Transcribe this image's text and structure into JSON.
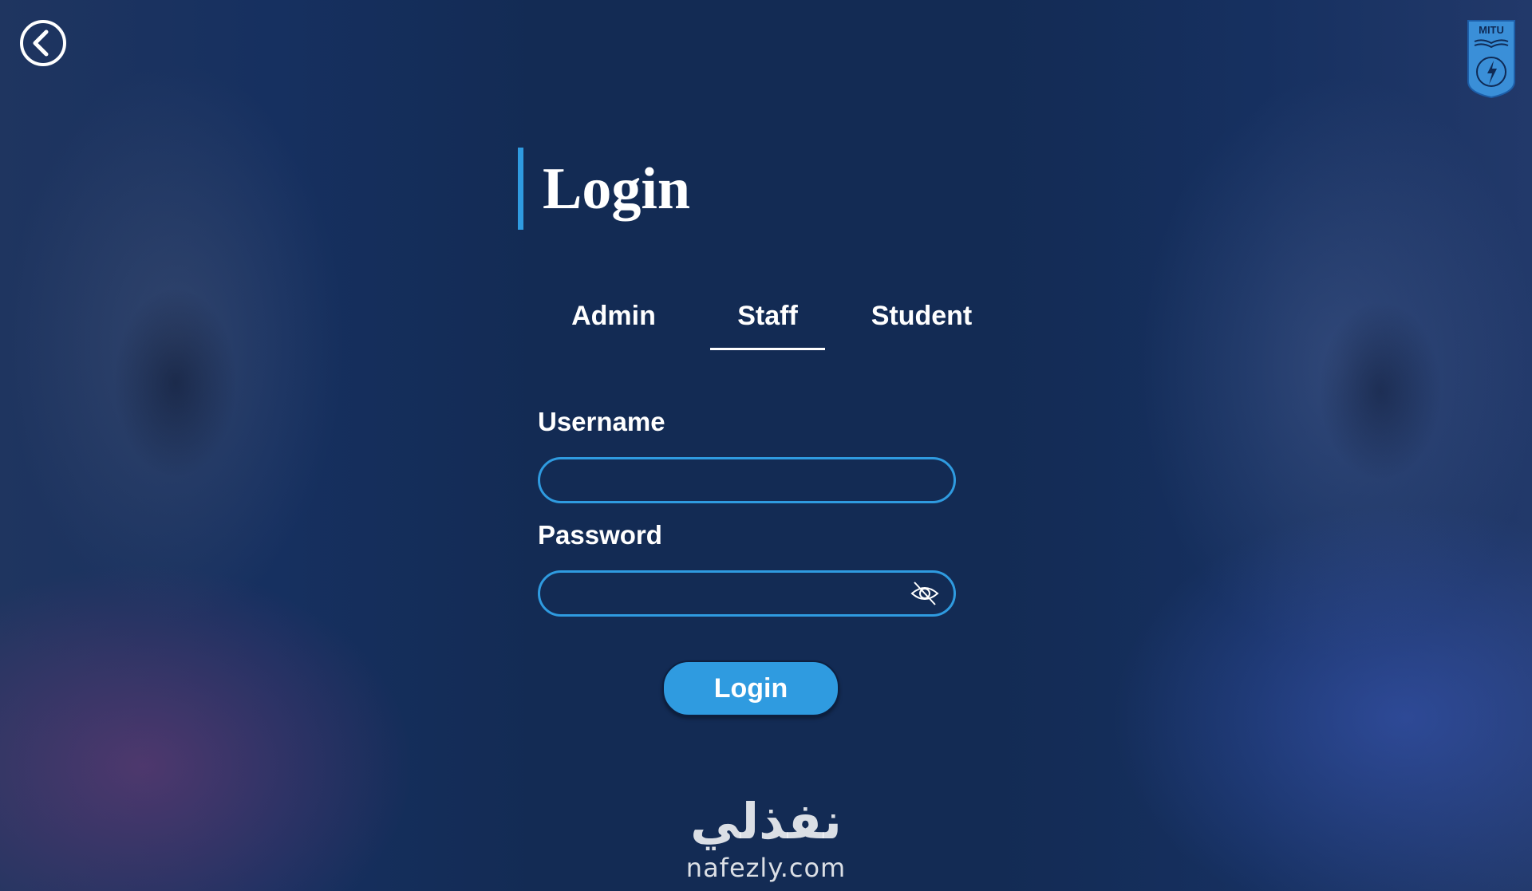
{
  "page": {
    "title": "Login"
  },
  "tabs": [
    {
      "label": "Admin",
      "active": false
    },
    {
      "label": "Staff",
      "active": true
    },
    {
      "label": "Student",
      "active": false
    }
  ],
  "form": {
    "username_label": "Username",
    "username_value": "",
    "password_label": "Password",
    "password_value": "",
    "submit_label": "Login"
  },
  "logo": {
    "text": "MITU"
  },
  "watermark": {
    "arabic": "نفذلي",
    "latin": "nafezly.com"
  },
  "icons": {
    "back": "chevron-left-circle-icon",
    "password_toggle": "eye-slash-icon",
    "logo": "university-shield-logo"
  },
  "colors": {
    "background": "#132b54",
    "accent": "#2f9be0",
    "text": "#ffffff"
  }
}
